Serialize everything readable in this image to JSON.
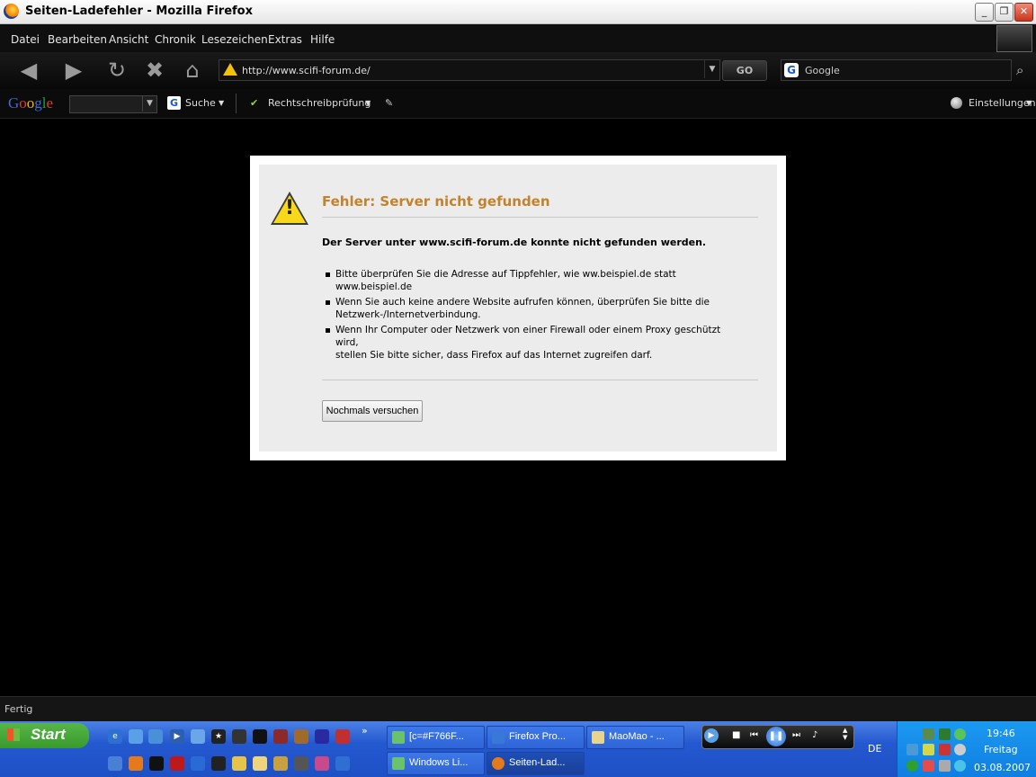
{
  "window": {
    "title": "Seiten-Ladefehler - Mozilla Firefox"
  },
  "menu": [
    "Datei",
    "Bearbeiten",
    "Ansicht",
    "Chronik",
    "Lesezeichen",
    "Extras",
    "Hilfe"
  ],
  "nav": {
    "url": "http://www.scifi-forum.de/",
    "go_label": "GO",
    "search_placeholder": "Google"
  },
  "google_toolbar": {
    "logo": "Google",
    "search_label": "Suche",
    "spell_label": "Rechtschreibprüfung",
    "settings_label": "Einstellungen"
  },
  "error": {
    "title": "Fehler: Server nicht gefunden",
    "description": "Der Server unter www.scifi-forum.de konnte nicht gefunden werden.",
    "bullets": [
      [
        "Bitte überprüfen Sie die Adresse auf Tippfehler, wie ww.beispiel.de statt",
        "www.beispiel.de"
      ],
      [
        "Wenn Sie auch keine andere Website aufrufen können, überprüfen Sie bitte die",
        "Netzwerk-/Internetverbindung."
      ],
      [
        "Wenn Ihr Computer oder Netzwerk von einer Firewall oder einem Proxy geschützt wird,",
        "stellen Sie bitte sicher, dass Firefox auf das Internet zugreifen darf."
      ]
    ],
    "retry_label": "Nochmals versuchen"
  },
  "status": {
    "text": "Fertig"
  },
  "taskbar": {
    "start_label": "Start",
    "tasks": [
      "[c=#F766F...",
      "Firefox Pro...",
      "MaoMao - ...",
      "Windows Li...",
      "Seiten-Lad..."
    ],
    "language": "DE",
    "clock": {
      "time": "19:46",
      "day": "Freitag",
      "date": "03.08.2007"
    }
  }
}
